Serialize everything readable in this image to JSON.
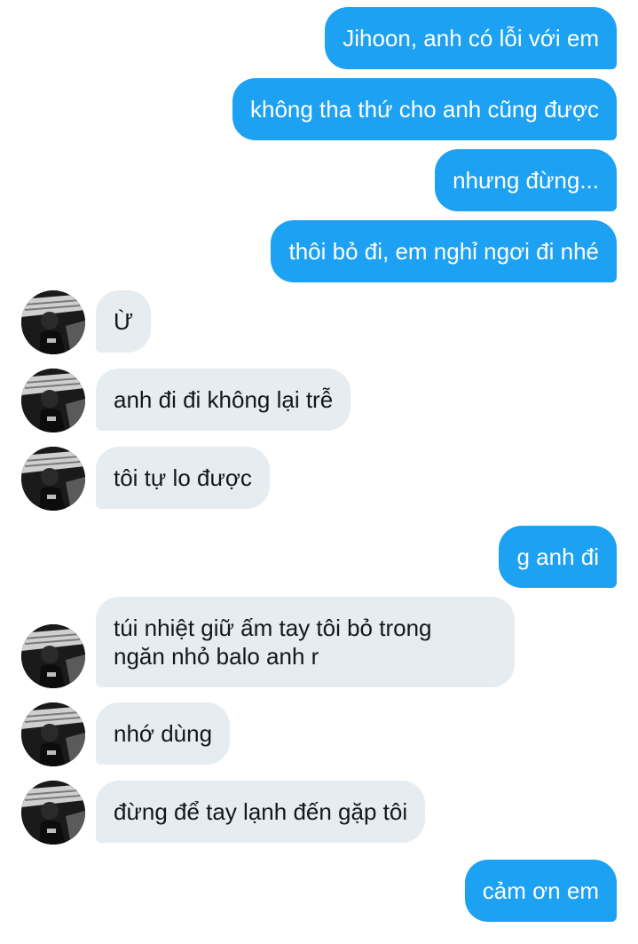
{
  "messages": [
    {
      "side": "out",
      "text": "Jihoon, anh có lỗi với em"
    },
    {
      "side": "out",
      "text": "không tha thứ cho anh cũng được"
    },
    {
      "side": "out",
      "text": "nhưng đừng..."
    },
    {
      "side": "out",
      "text": "thôi bỏ đi, em nghỉ ngơi đi nhé"
    },
    {
      "side": "in",
      "text": "Ừ"
    },
    {
      "side": "in",
      "text": "anh đi đi không lại trễ"
    },
    {
      "side": "in",
      "text": "tôi tự lo được"
    },
    {
      "side": "out",
      "text": "g anh đi"
    },
    {
      "side": "in",
      "lines": [
        "túi nhiệt giữ ấm tay tôi bỏ trong",
        "ngăn nhỏ balo anh r"
      ]
    },
    {
      "side": "in",
      "text": "nhớ dùng"
    },
    {
      "side": "in",
      "text": "đừng để tay lạnh đến gặp tôi"
    },
    {
      "side": "out",
      "text": "cảm ơn em"
    }
  ],
  "avatar_icon": "contact-photo-icon",
  "colors": {
    "outgoing_bubble": "#1da1f2",
    "outgoing_text": "#ffffff",
    "incoming_bubble": "#e6ecf0",
    "incoming_text": "#14171a",
    "background": "#ffffff"
  }
}
